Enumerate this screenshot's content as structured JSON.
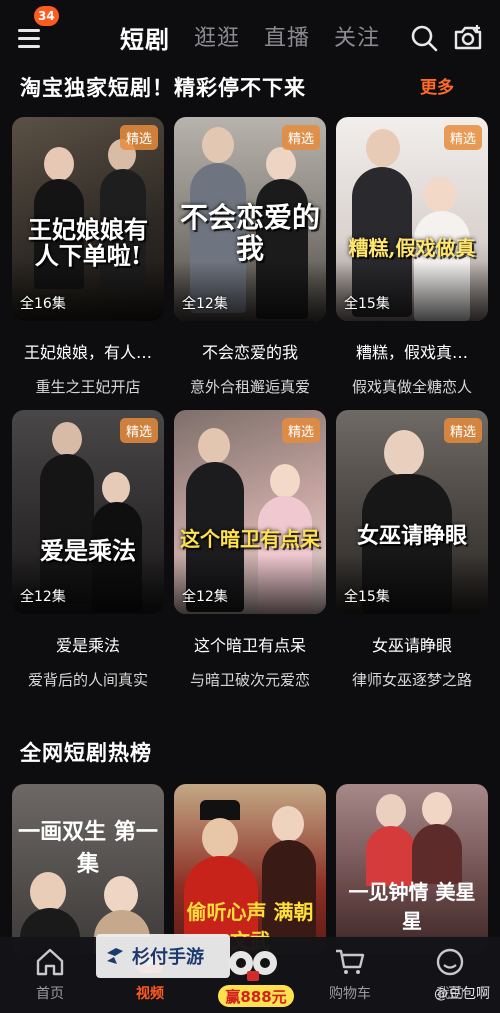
{
  "header": {
    "badge_count": "34",
    "tabs": [
      {
        "label": "短剧",
        "active": true
      },
      {
        "label": "逛逛",
        "active": false
      },
      {
        "label": "直播",
        "active": false
      },
      {
        "label": "关注",
        "active": false
      }
    ]
  },
  "exclusive": {
    "title": "淘宝独家短剧！精彩停不下来",
    "more_label": "更多"
  },
  "cards": [
    {
      "poster_text": "王妃娘娘有人下单啦!",
      "tag": "精选",
      "episodes": "全16集",
      "title": "王妃娘娘，有人…",
      "subtitle": "重生之王妃开店"
    },
    {
      "poster_text": "不会恋爱的我",
      "tag": "精选",
      "episodes": "全12集",
      "title": "不会恋爱的我",
      "subtitle": "意外合租邂逅真爱"
    },
    {
      "poster_text": "糟糕,假戏做真",
      "tag": "精选",
      "episodes": "全15集",
      "title": "糟糕，假戏真…",
      "subtitle": "假戏真做全糖恋人"
    },
    {
      "poster_text": "爱是乘法",
      "tag": "精选",
      "episodes": "全12集",
      "title": "爱是乘法",
      "subtitle": "爱背后的人间真实"
    },
    {
      "poster_text": "这个暗卫有点呆",
      "tag": "精选",
      "episodes": "全12集",
      "title": "这个暗卫有点呆",
      "subtitle": "与暗卫破次元爱恋"
    },
    {
      "poster_text": "女巫请睁眼",
      "tag": "精选",
      "episodes": "全15集",
      "title": "女巫请睁眼",
      "subtitle": "律师女巫逐梦之路"
    }
  ],
  "ranking": {
    "title": "全网短剧热榜",
    "posters": [
      {
        "poster_text": "一画双生 第一集"
      },
      {
        "poster_text": "偷听心声 满朝文武"
      },
      {
        "poster_text": "一见钟情 美星星"
      }
    ]
  },
  "bottom_nav": {
    "items": [
      {
        "label": "首页",
        "active": false
      },
      {
        "label": "视频",
        "active": true
      },
      {
        "label": "购物车",
        "active": false
      },
      {
        "label": "我的",
        "active": false
      }
    ],
    "promo_amount": "赢888元"
  },
  "watermark": {
    "text": "杉付手游",
    "corner": "@豆包啊"
  },
  "colors": {
    "accent": "#ff5a1f",
    "background": "#0d0d0f"
  }
}
